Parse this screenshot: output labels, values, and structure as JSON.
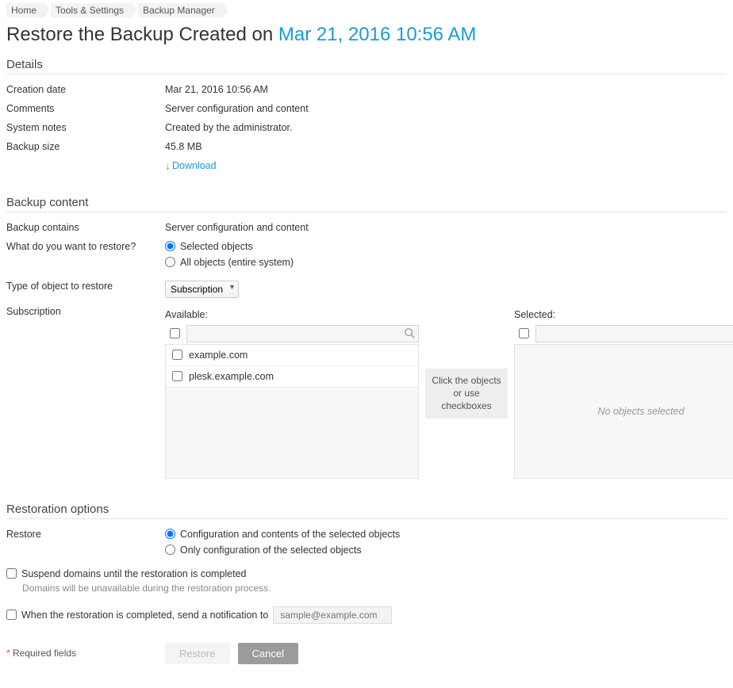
{
  "breadcrumb": {
    "items": [
      "Home",
      "Tools & Settings",
      "Backup Manager"
    ]
  },
  "title": {
    "prefix": "Restore the Backup Created on ",
    "accent": "Mar 21, 2016 10:56 AM"
  },
  "details": {
    "header": "Details",
    "creation_date_label": "Creation date",
    "creation_date_value": "Mar 21, 2016 10:56 AM",
    "comments_label": "Comments",
    "comments_value": "Server configuration and content",
    "system_notes_label": "System notes",
    "system_notes_value": "Created by the administrator.",
    "backup_size_label": "Backup size",
    "backup_size_value": "45.8 MB",
    "download_label": "Download"
  },
  "backup_content": {
    "header": "Backup content",
    "contains_label": "Backup contains",
    "contains_value": "Server configuration and content",
    "restore_what_label": "What do you want to restore?",
    "option_selected": "Selected objects",
    "option_all": "All objects (entire system)",
    "type_label": "Type of object to restore",
    "type_selected": "Subscription",
    "subscription_label": "Subscription",
    "available_header": "Available:",
    "selected_header": "Selected:",
    "available_items": [
      "example.com",
      "plesk.example.com"
    ],
    "hint_text": "Click the objects or use checkboxes",
    "no_selected_text": "No objects selected"
  },
  "restoration": {
    "header": "Restoration options",
    "restore_label": "Restore",
    "option_config_contents": "Configuration and contents of the selected objects",
    "option_config_only": "Only configuration of the selected objects",
    "suspend_label": "Suspend domains until the restoration is completed",
    "suspend_help": "Domains will be unavailable during the restoration process.",
    "notify_label": "When the restoration is completed, send a notification to",
    "notify_placeholder": "sample@example.com"
  },
  "footer": {
    "required_text": "Required fields",
    "restore_btn": "Restore",
    "cancel_btn": "Cancel"
  }
}
